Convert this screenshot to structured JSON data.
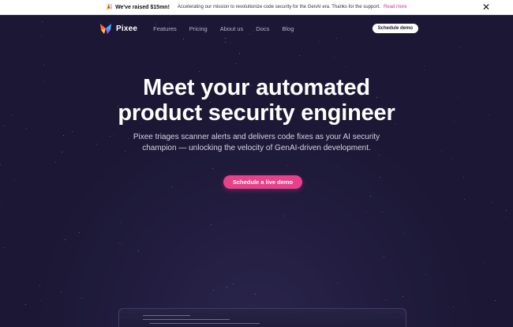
{
  "announcement": {
    "emoji": "🎉",
    "raised": "We've raised $15mn!",
    "message": "Accelerating our mission to revolutionize code security for the GenAI era. Thanks for the support.",
    "link": "Read more",
    "close_icon": "✕"
  },
  "nav": {
    "brand": "Pixee",
    "links": [
      "Features",
      "Pricing",
      "About us",
      "Docs",
      "Blog"
    ],
    "cta": "Schedule demo"
  },
  "hero": {
    "headline_line1": "Meet your automated",
    "headline_line2": "product security engineer",
    "sub_line1": "Pixee triages scanner alerts and delivers code fixes as your AI security",
    "sub_line2": "champion — unlocking the velocity of GenAI-driven development.",
    "cta": "Schedule a live demo"
  },
  "colors": {
    "background": "#1b1734",
    "accent": "#e8418a"
  }
}
